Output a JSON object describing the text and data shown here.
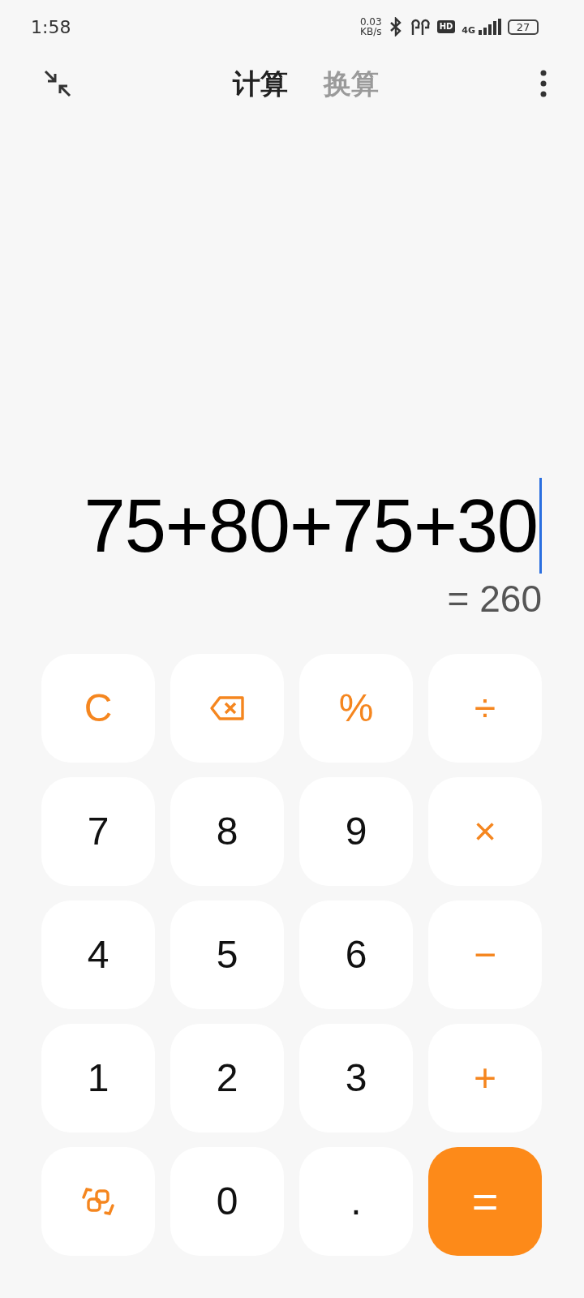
{
  "status_bar": {
    "time": "1:58",
    "net_speed": "0.03",
    "net_unit": "KB/s",
    "hd": "HD",
    "network": "4G",
    "battery": "27"
  },
  "tabs": [
    {
      "label": "计算",
      "selected": true
    },
    {
      "label": "换算",
      "selected": false
    }
  ],
  "display": {
    "expression": "75+80+75+30",
    "result": "= 260"
  },
  "keys": [
    {
      "kind": "clear",
      "label": "C"
    },
    {
      "kind": "backspace"
    },
    {
      "kind": "operator",
      "label": "%"
    },
    {
      "kind": "operator",
      "label": "÷"
    },
    {
      "kind": "digit",
      "label": "7"
    },
    {
      "kind": "digit",
      "label": "8"
    },
    {
      "kind": "digit",
      "label": "9"
    },
    {
      "kind": "operator",
      "label": "×"
    },
    {
      "kind": "digit",
      "label": "4"
    },
    {
      "kind": "digit",
      "label": "5"
    },
    {
      "kind": "digit",
      "label": "6"
    },
    {
      "kind": "operator",
      "label": "−"
    },
    {
      "kind": "digit",
      "label": "1"
    },
    {
      "kind": "digit",
      "label": "2"
    },
    {
      "kind": "digit",
      "label": "3"
    },
    {
      "kind": "operator",
      "label": "+"
    },
    {
      "kind": "mode"
    },
    {
      "kind": "digit",
      "label": "0"
    },
    {
      "kind": "digit",
      "label": "."
    },
    {
      "kind": "equals",
      "label": "="
    }
  ]
}
